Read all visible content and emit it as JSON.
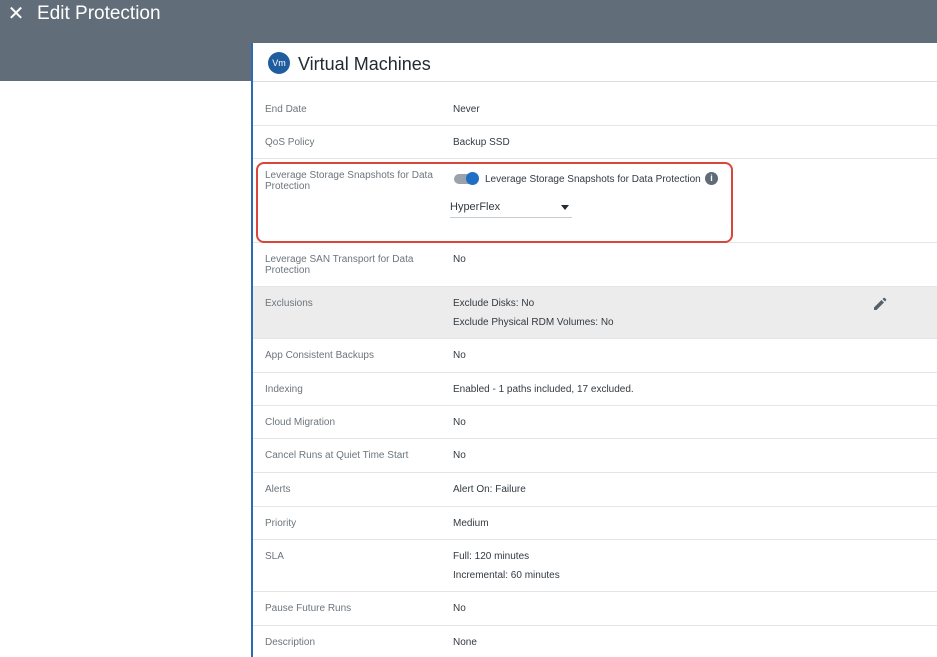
{
  "header": {
    "title": "Edit Protection",
    "close_icon": "close-icon"
  },
  "panel": {
    "badge": "Vm",
    "title": "Virtual Machines"
  },
  "rows": {
    "end_date": {
      "label": "End Date",
      "value": "Never"
    },
    "qos": {
      "label": "QoS Policy",
      "value": "Backup SSD"
    },
    "storage_snapshots": {
      "label": "Leverage Storage Snapshots for Data Protection",
      "toggle_label": "Leverage Storage Snapshots for Data Protection",
      "toggle_on": true,
      "select_value": "HyperFlex"
    },
    "san": {
      "label": "Leverage SAN Transport for Data Protection",
      "value": "No"
    },
    "exclusions": {
      "label": "Exclusions",
      "value_1": "Exclude Disks: No",
      "value_2": "Exclude Physical RDM Volumes: No"
    },
    "app_consistent": {
      "label": "App Consistent Backups",
      "value": "No"
    },
    "indexing": {
      "label": "Indexing",
      "value": "Enabled - 1 paths included, 17 excluded."
    },
    "cloud_migration": {
      "label": "Cloud Migration",
      "value": "No"
    },
    "cancel_runs": {
      "label": "Cancel Runs at Quiet Time Start",
      "value": "No"
    },
    "alerts": {
      "label": "Alerts",
      "value": "Alert On: Failure"
    },
    "priority": {
      "label": "Priority",
      "value": "Medium"
    },
    "sla": {
      "label": "SLA",
      "value_1": "Full: 120 minutes",
      "value_2": "Incremental: 60 minutes"
    },
    "pause": {
      "label": "Pause Future Runs",
      "value": "No"
    },
    "description": {
      "label": "Description",
      "value": "None"
    }
  },
  "colors": {
    "header_bg": "#616d78",
    "accent": "#1f6fc5",
    "highlight": "#d9463a",
    "shaded_row": "#ececec"
  }
}
